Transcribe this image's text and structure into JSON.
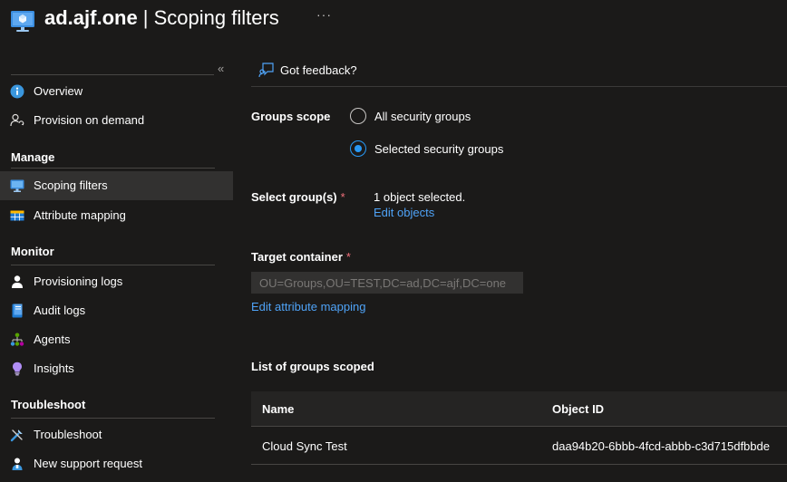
{
  "header": {
    "title_bold": "ad.ajf.one",
    "title_rest": " | Scoping filters",
    "more": "···"
  },
  "sidebar": {
    "collapse": "«",
    "items_top": [
      {
        "label": "Overview",
        "icon": "info-icon"
      },
      {
        "label": "Provision on demand",
        "icon": "person-sync-icon"
      }
    ],
    "manage": {
      "title": "Manage",
      "items": [
        {
          "label": "Scoping filters",
          "icon": "monitor-icon",
          "active": true
        },
        {
          "label": "Attribute mapping",
          "icon": "table-icon"
        }
      ]
    },
    "monitor": {
      "title": "Monitor",
      "items": [
        {
          "label": "Provisioning logs",
          "icon": "person-icon"
        },
        {
          "label": "Audit logs",
          "icon": "log-book-icon"
        },
        {
          "label": "Agents",
          "icon": "hierarchy-icon"
        },
        {
          "label": "Insights",
          "icon": "lightbulb-icon"
        }
      ]
    },
    "troubleshoot": {
      "title": "Troubleshoot",
      "items": [
        {
          "label": "Troubleshoot",
          "icon": "wrench-icon"
        },
        {
          "label": "New support request",
          "icon": "person-support-icon"
        }
      ]
    }
  },
  "main": {
    "feedback": "Got feedback?",
    "groups_scope": {
      "label": "Groups scope",
      "options": [
        {
          "label": "All security groups",
          "selected": false
        },
        {
          "label": "Selected security groups",
          "selected": true
        }
      ]
    },
    "select_groups": {
      "label": "Select group(s)",
      "required": "*",
      "value": "1 object selected.",
      "link": "Edit objects"
    },
    "target_container": {
      "label": "Target container",
      "required": "*",
      "value": "OU=Groups,OU=TEST,DC=ad,DC=ajf,DC=one",
      "link": "Edit attribute mapping"
    },
    "list": {
      "title": "List of groups scoped",
      "columns": [
        "Name",
        "Object ID"
      ],
      "rows": [
        [
          "Cloud Sync Test",
          "daa94b20-6bbb-4fcd-abbb-c3d715dfbbde"
        ]
      ]
    }
  },
  "colors": {
    "background": "#1b1a19",
    "accent": "#2899f5",
    "link": "#4fa3f7",
    "required": "#f1707b"
  }
}
